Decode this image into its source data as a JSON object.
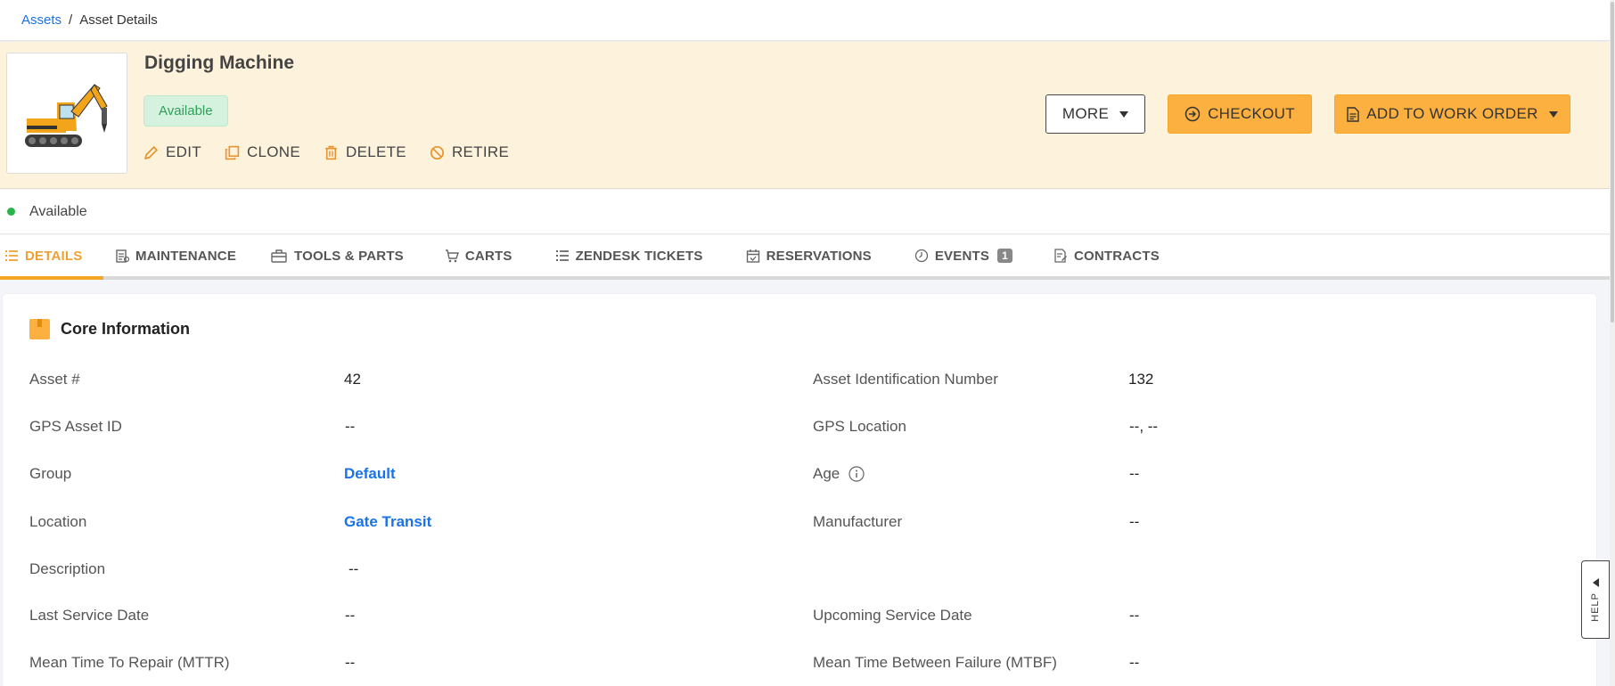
{
  "breadcrumb": {
    "parent": "Assets",
    "separator": "/",
    "current": "Asset Details"
  },
  "header": {
    "title": "Digging Machine",
    "status_pill": "Available",
    "actions": {
      "edit": "EDIT",
      "clone": "CLONE",
      "delete": "DELETE",
      "retire": "RETIRE"
    },
    "buttons": {
      "more": "MORE",
      "checkout": "CHECKOUT",
      "add_to_work_order": "ADD TO WORK ORDER"
    }
  },
  "status_line": {
    "text": "Available",
    "color": "#28b44a"
  },
  "tabs": [
    {
      "label": "DETAILS",
      "icon": "list-icon",
      "active": true
    },
    {
      "label": "MAINTENANCE",
      "icon": "clipboard-icon"
    },
    {
      "label": "TOOLS & PARTS",
      "icon": "toolbox-icon"
    },
    {
      "label": "CARTS",
      "icon": "cart-icon"
    },
    {
      "label": "ZENDESK TICKETS",
      "icon": "list-icon"
    },
    {
      "label": "RESERVATIONS",
      "icon": "calendar-icon"
    },
    {
      "label": "EVENTS",
      "icon": "clock-icon",
      "badge": "1"
    },
    {
      "label": "CONTRACTS",
      "icon": "contract-icon"
    }
  ],
  "core": {
    "title": "Core Information",
    "fields": {
      "asset_num": {
        "label": "Asset #",
        "value": "42"
      },
      "asset_id_num": {
        "label": "Asset Identification Number",
        "value": "132"
      },
      "gps_asset_id": {
        "label": "GPS Asset ID",
        "value": "--"
      },
      "gps_location": {
        "label": "GPS Location",
        "value": "--, --"
      },
      "group": {
        "label": "Group",
        "value": "Default"
      },
      "age": {
        "label": "Age",
        "value": "--"
      },
      "location": {
        "label": "Location",
        "value": "Gate Transit"
      },
      "manufacturer": {
        "label": "Manufacturer",
        "value": "--"
      },
      "description": {
        "label": "Description",
        "value": "--"
      },
      "last_service": {
        "label": "Last Service Date",
        "value": "--"
      },
      "upcoming_service": {
        "label": "Upcoming Service Date",
        "value": "--"
      },
      "mttr": {
        "label": "Mean Time To Repair (MTTR)",
        "value": "--"
      },
      "mtbf": {
        "label": "Mean Time Between Failure (MTBF)",
        "value": "--"
      }
    }
  },
  "help": {
    "label": "HELP"
  },
  "colors": {
    "accent": "#fbb040",
    "link": "#1a73e8",
    "header_bg": "#fdf2dc"
  }
}
